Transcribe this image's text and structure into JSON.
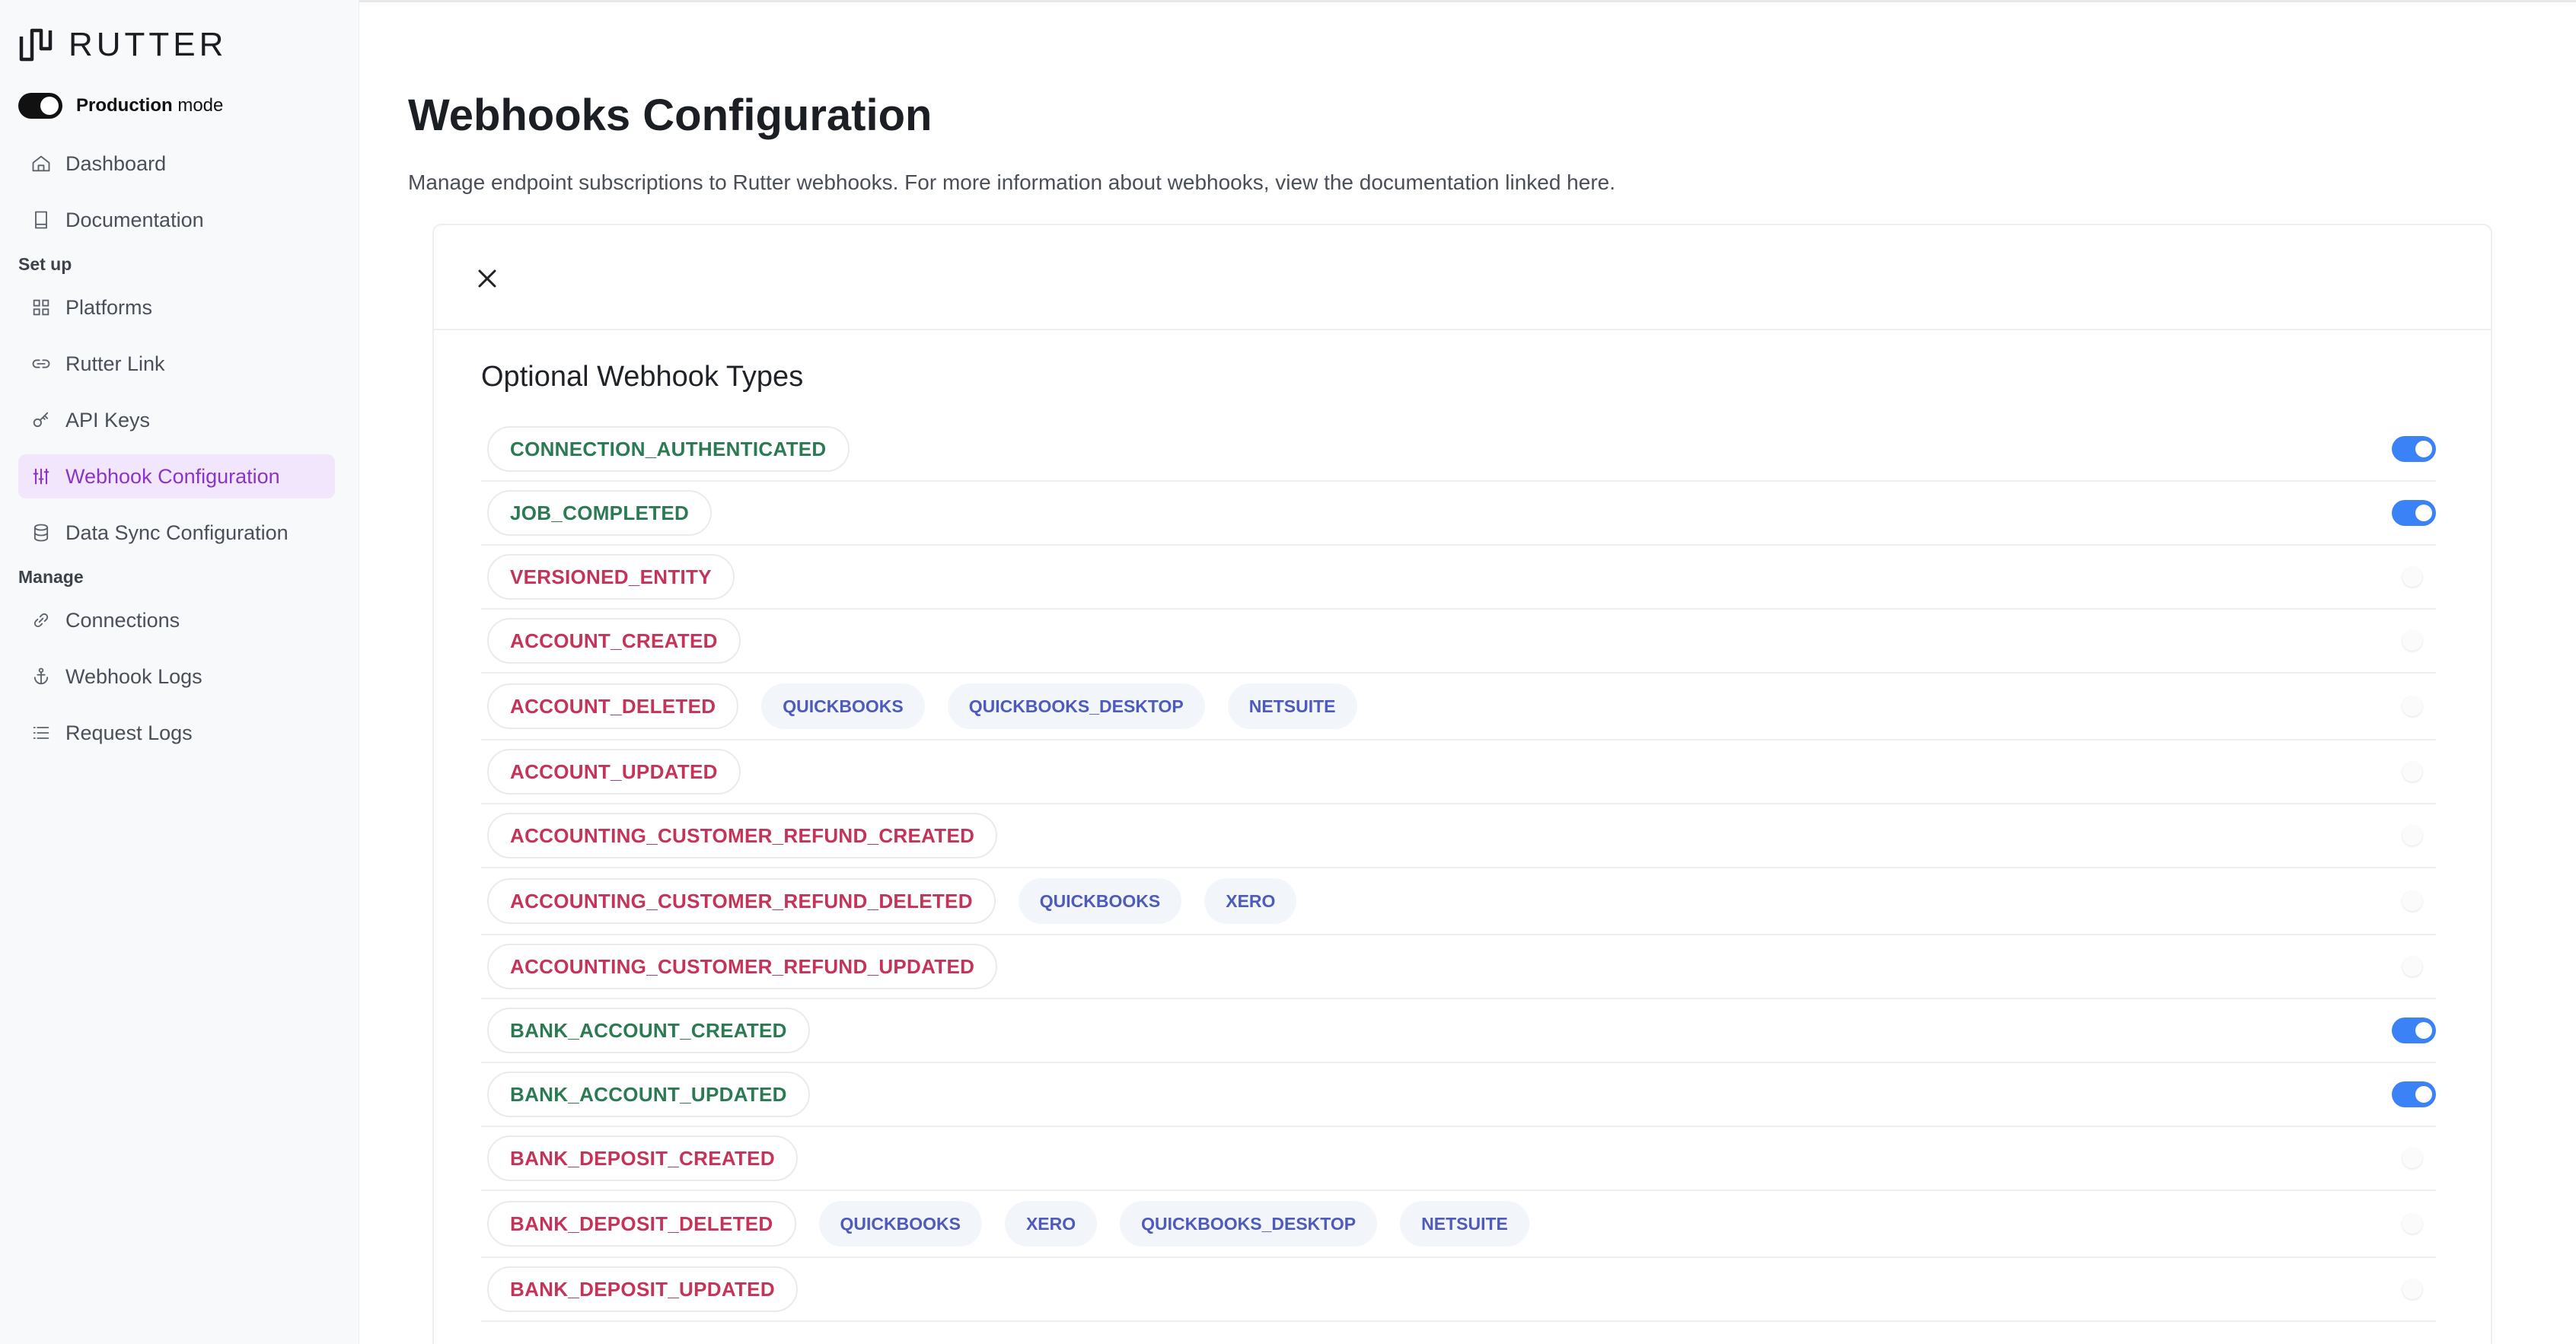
{
  "brand": {
    "name": "RUTTER"
  },
  "mode": {
    "label_bold": "Production",
    "label_rest": " mode",
    "enabled": true
  },
  "nav_top": [
    {
      "label": "Dashboard",
      "icon": "home-icon"
    },
    {
      "label": "Documentation",
      "icon": "book-icon"
    }
  ],
  "sections": {
    "setup": {
      "label": "Set up",
      "items": [
        {
          "label": "Platforms",
          "icon": "grid-icon"
        },
        {
          "label": "Rutter Link",
          "icon": "link-icon"
        },
        {
          "label": "API Keys",
          "icon": "key-icon"
        },
        {
          "label": "Webhook Configuration",
          "icon": "sliders-icon",
          "active": true
        },
        {
          "label": "Data Sync Configuration",
          "icon": "database-icon"
        }
      ]
    },
    "manage": {
      "label": "Manage",
      "items": [
        {
          "label": "Connections",
          "icon": "chain-icon"
        },
        {
          "label": "Webhook Logs",
          "icon": "anchor-icon"
        },
        {
          "label": "Request Logs",
          "icon": "list-icon"
        }
      ]
    }
  },
  "page": {
    "title": "Webhooks Configuration",
    "description": "Manage endpoint subscriptions to Rutter webhooks. For more information about webhooks, view the documentation linked here."
  },
  "card": {
    "section_title": "Optional Webhook Types"
  },
  "webhooks": [
    {
      "name": "CONNECTION_AUTHENTICATED",
      "enabled": true,
      "platforms": []
    },
    {
      "name": "JOB_COMPLETED",
      "enabled": true,
      "platforms": []
    },
    {
      "name": "VERSIONED_ENTITY",
      "enabled": false,
      "platforms": []
    },
    {
      "name": "ACCOUNT_CREATED",
      "enabled": false,
      "platforms": []
    },
    {
      "name": "ACCOUNT_DELETED",
      "enabled": false,
      "platforms": [
        "QUICKBOOKS",
        "QUICKBOOKS_DESKTOP",
        "NETSUITE"
      ]
    },
    {
      "name": "ACCOUNT_UPDATED",
      "enabled": false,
      "platforms": []
    },
    {
      "name": "ACCOUNTING_CUSTOMER_REFUND_CREATED",
      "enabled": false,
      "platforms": []
    },
    {
      "name": "ACCOUNTING_CUSTOMER_REFUND_DELETED",
      "enabled": false,
      "platforms": [
        "QUICKBOOKS",
        "XERO"
      ]
    },
    {
      "name": "ACCOUNTING_CUSTOMER_REFUND_UPDATED",
      "enabled": false,
      "platforms": []
    },
    {
      "name": "BANK_ACCOUNT_CREATED",
      "enabled": true,
      "platforms": []
    },
    {
      "name": "BANK_ACCOUNT_UPDATED",
      "enabled": true,
      "platforms": []
    },
    {
      "name": "BANK_DEPOSIT_CREATED",
      "enabled": false,
      "platforms": []
    },
    {
      "name": "BANK_DEPOSIT_DELETED",
      "enabled": false,
      "platforms": [
        "QUICKBOOKS",
        "XERO",
        "QUICKBOOKS_DESKTOP",
        "NETSUITE"
      ]
    },
    {
      "name": "BANK_DEPOSIT_UPDATED",
      "enabled": false,
      "platforms": []
    }
  ],
  "colors": {
    "enabled_text": "#2a7a52",
    "disabled_text": "#c53358",
    "platform_text": "#4e5bbd",
    "toggle_on": "#3b82f6",
    "active_nav_bg": "#f1e6fb",
    "active_nav_text": "#8a35c9"
  }
}
